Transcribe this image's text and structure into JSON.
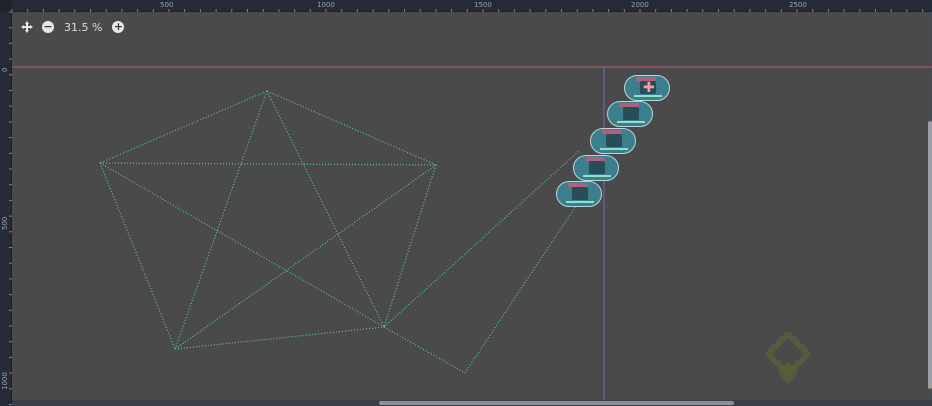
{
  "ruler": {
    "top_labels": [
      "500",
      "1000",
      "1500",
      "2000",
      "2500"
    ],
    "left_labels": [
      "0",
      "500",
      "1000"
    ]
  },
  "toolbar": {
    "pan_icon": "move-icon",
    "zoom_out_icon": "minus-circle-icon",
    "zoom_level": "31.5 %",
    "zoom_in_icon": "plus-circle-icon"
  },
  "colors": {
    "canvas": "#4a4a4a",
    "edge": "#5fc3a4",
    "guide_horizontal": "#c05a6a",
    "guide_vertical": "#6e66c8",
    "node_fill": "#3b7f8c"
  },
  "graph": {
    "pentagram_vertices": 5,
    "path_nodes": 5
  }
}
